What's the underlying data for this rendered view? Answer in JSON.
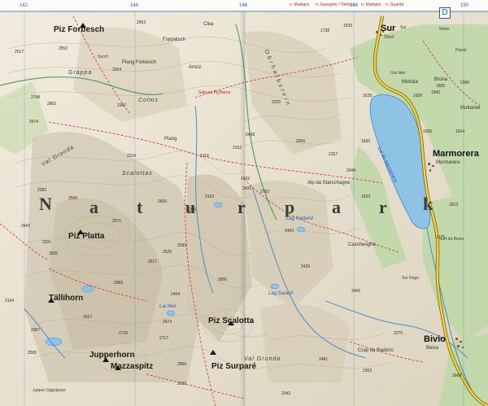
{
  "grid": {
    "g142": "142",
    "g144": "144",
    "g146": "146",
    "g148": "148",
    "g150": "150",
    "cell_d": "D"
  },
  "edge_labels": {
    "n_mulegns": "n. Mulegns",
    "n_savognin": "n. Savognin / Tiefenc.",
    "n_mulegns2": "n. Mulegns",
    "n_guarda": "n. Guarda"
  },
  "towns": {
    "sur": "Sur",
    "sur_sub": "Sour",
    "marmorera": "Marmorera",
    "marmorera_sub": "Murmarera",
    "bivio": "Bivio",
    "bivio_sub": "Beiva"
  },
  "peaks": {
    "piz_forbesch": "Piz Forbesch",
    "piz_platta": "Piz Platta",
    "tallhorn": "Tällihorn",
    "jupperhorn": "Jupperhorn",
    "mazzaspitz": "Mazzaspitz",
    "piz_scalotta": "Piz Scalotta",
    "piz_surparé": "Piz Surparé"
  },
  "region": {
    "n": "N",
    "a": "a",
    "t": "t",
    "u": "u",
    "r": "r",
    "p": "p",
    "a2": "a",
    "r2": "r",
    "k": "k"
  },
  "lakes": {
    "lai_marmorera": "Lai da Marmorera",
    "lag_radund": "Lag Radund",
    "lag_sarash": "Lag Sarash",
    "lag_neir": "Lai Neir"
  },
  "ridges": {
    "ridge_oberhalbstein": "Obrhalbstein",
    "val_gronda": "Val Gronda",
    "val_gronda2": "Val Gronda",
    "scalottas": "Scalottas",
    "colms": "Colms",
    "grappa": "Grappa"
  },
  "misc": {
    "fall_sur": "Sur",
    "clea": "Clea",
    "foppatsch": "Foppatsch",
    "plang_forbesch": "Plang Forbesch",
    "amoz": "Amoz",
    "salouru": "Salouru Pg Barca",
    "sanct": "Sanct",
    "plang": "Plang",
    "crap_radons": "Crap da Radons",
    "cascheogna": "Cascheogna",
    "alp_starschagne": "Alp da Starschagne",
    "mottala": "Mottala",
    "got_neir": "Got Neir",
    "brüna": "Brüna",
    "muttaniel": "Muttaniel",
    "sur_ragn": "Sur Ragn",
    "surt_bev": "Surt da Beiva",
    "jupper_oggst": "Jupper Oggstpass",
    "mater": "Mater",
    "plazbi": "Plazbi"
  },
  "altitudes": {
    "a2563": "2563",
    "a2517": "2517",
    "a2552": "2552",
    "a2554": "2554",
    "a2748": "2748",
    "a2863": "2863",
    "a2574": "2574",
    "a2367": "2367",
    "a2224": "2224",
    "a2382": "2382",
    "a2506": "2506",
    "a2605": "2605",
    "a2356": "2356",
    "a2642": "2642",
    "a3071": "3071",
    "a2331": "2331",
    "a3005": "3005",
    "a2525": "2525",
    "a2617": "2617",
    "a2593": "2593",
    "a2965": "2965",
    "a2404": "2404",
    "a2474": "2474",
    "a2164": "2164",
    "a2917": "2917",
    "a2720": "2720",
    "a2717": "2717",
    "a2987": "2987",
    "a2595": "2595",
    "a2806": "2806",
    "a2639": "2639",
    "a2114": "2114",
    "a2162": "2162",
    "a2163": "2163",
    "a2432": "2432",
    "a2431": "2431",
    "a2792": "2792",
    "a2225": "2225",
    "a2438": "2438",
    "a2666": "2666",
    "a2157": "2157",
    "a2044": "2044",
    "a1923": "1923",
    "a2403": "2403",
    "a2425": "2425",
    "a2900": "2900",
    "a2466": "2466",
    "a2275": "2275",
    "a2352": "2352",
    "a2481": "2481",
    "a2342": "2342",
    "a1738": "1738",
    "a1525": "1525",
    "a1628": "1628",
    "a1660": "1660",
    "a1690": "1690",
    "a1926": "1926",
    "a1842": "1842",
    "a1855": "1855",
    "a1775": "1775",
    "a1668": "1668",
    "a2366": "2366",
    "a1813": "1813",
    "a1914": "1914"
  },
  "colors": {
    "terrain": "#e9e3d2",
    "forest": "#bfd9a8",
    "lake": "#8fc3e6",
    "road": "#f2d53c",
    "trail": "#d0342c",
    "river": "#3a86c8",
    "contour": "#b7a486",
    "boundary": "#3f9a5c"
  }
}
